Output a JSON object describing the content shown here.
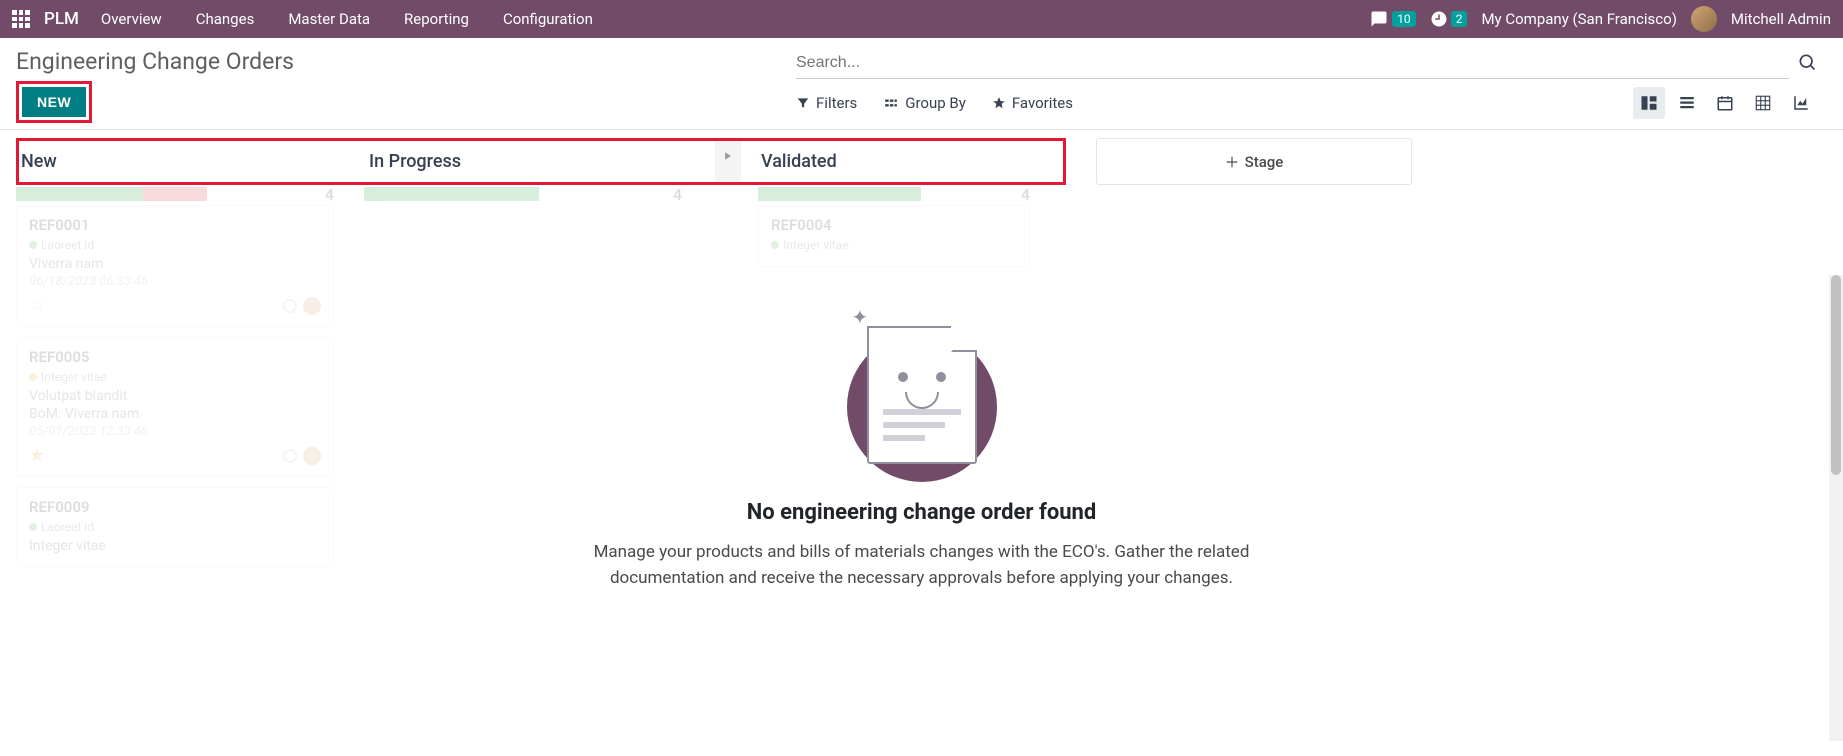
{
  "topbar": {
    "app_name": "PLM",
    "nav": [
      "Overview",
      "Changes",
      "Master Data",
      "Reporting",
      "Configuration"
    ],
    "messages_count": "10",
    "activities_count": "2",
    "company": "My Company (San Francisco)",
    "user": "Mitchell Admin"
  },
  "page": {
    "title": "Engineering Change Orders",
    "new_button": "NEW"
  },
  "search": {
    "placeholder": "Search...",
    "filters": "Filters",
    "group_by": "Group By",
    "favorites": "Favorites"
  },
  "stages": {
    "col1": "New",
    "col2": "In Progress",
    "col3": "Validated",
    "add": "Stage"
  },
  "ghost": {
    "col1_count": "4",
    "col2_count": "4",
    "col3_count": "4",
    "card1": {
      "ref": "REF0001",
      "tag": "Laoreet id",
      "line1": "Viverra nam",
      "date": "06/18/2023 06:33:46"
    },
    "card2": {
      "ref": "REF0005",
      "tag": "Integer vitae",
      "line1": "Volutpat blandit",
      "line2": "BoM: Viverra nam",
      "date": "05/01/2023 12:33:46"
    },
    "card3": {
      "ref": "REF0009",
      "tag": "Laoreet id",
      "line1": "Integer vitae"
    },
    "col3_card": {
      "ref": "REF0004",
      "tag": "Integer vitae"
    }
  },
  "empty": {
    "title": "No engineering change order found",
    "desc": "Manage your products and bills of materials changes with the ECO's. Gather the related documentation and receive the necessary approvals before applying your changes."
  }
}
